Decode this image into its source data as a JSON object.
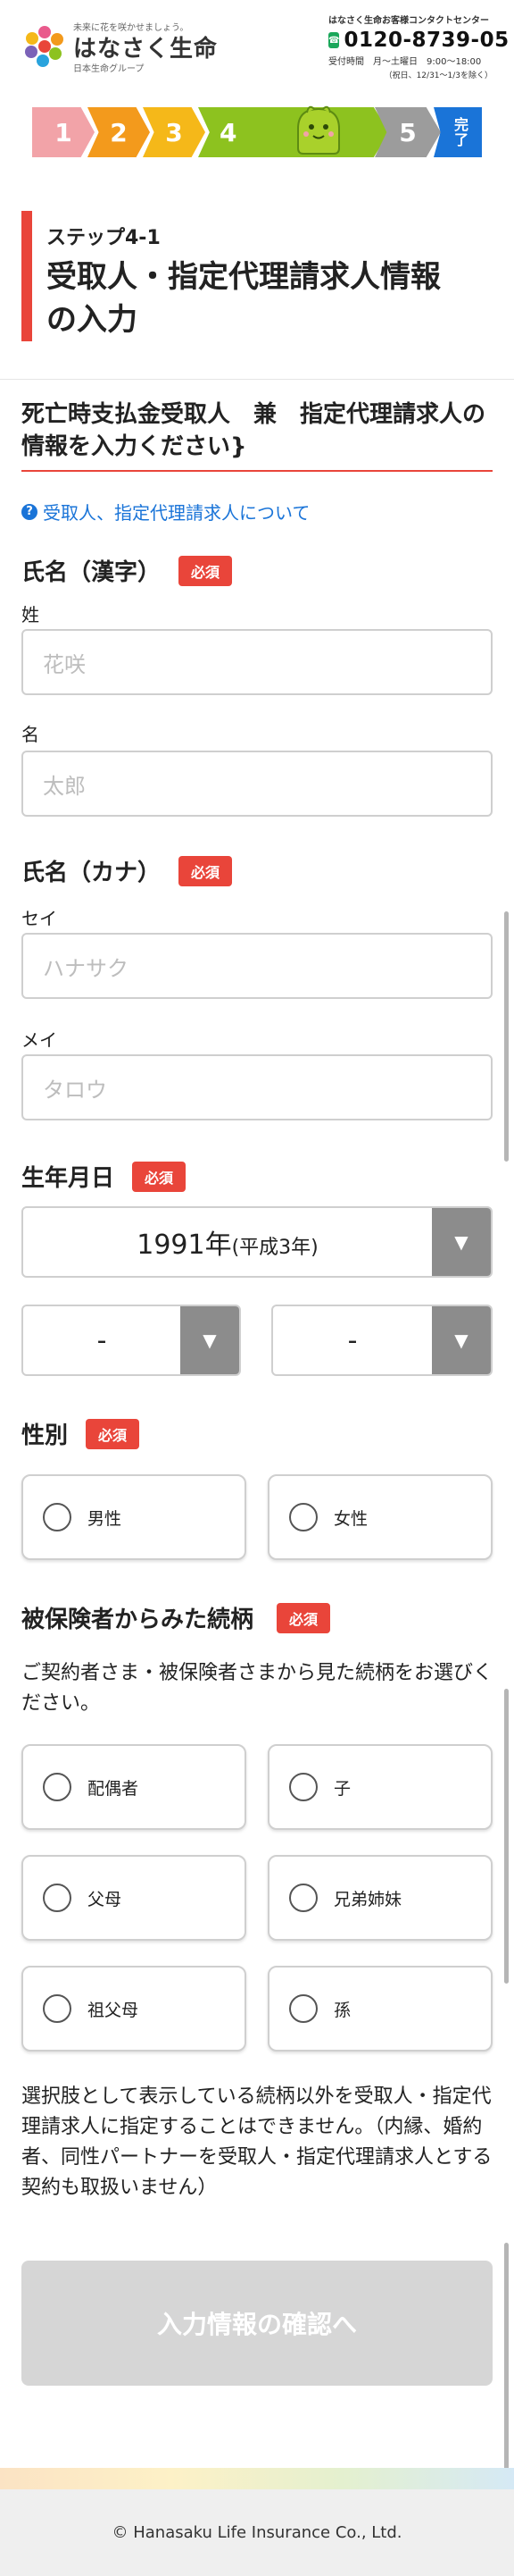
{
  "header": {
    "tagline": "未来に花を咲かせましょう。",
    "logo_name": "はなさく生命",
    "logo_group": "日本生命グループ",
    "contact_title": "はなさく生命お客様コンタクトセンター",
    "freedial_label": "0120",
    "phone": "0120-8739-05",
    "hours": "受付時間　月～土曜日　9:00～18:00",
    "hours_note": "（祝日、12/31～1/3を除く）"
  },
  "stepper": {
    "steps": [
      "1",
      "2",
      "3",
      "4",
      "5",
      "完了"
    ],
    "current_step": "4"
  },
  "page": {
    "step_label": "ステップ4-1",
    "title_line1": "受取人・指定代理請求人情報",
    "title_line2": "の入力"
  },
  "section": {
    "heading": "死亡時支払金受取人　兼　指定代理請求人の情報を入力ください}",
    "help_link": "受取人、指定代理請求人について"
  },
  "form": {
    "required_label": "必須",
    "name_kanji": {
      "label": "氏名（漢字）",
      "last_label": "姓",
      "last_placeholder": "花咲",
      "first_label": "名",
      "first_placeholder": "太郎"
    },
    "name_kana": {
      "label": "氏名（カナ）",
      "last_label": "セイ",
      "last_placeholder": "ハナサク",
      "first_label": "メイ",
      "first_placeholder": "タロウ"
    },
    "birthdate": {
      "label": "生年月日",
      "year_value": "1991年",
      "year_era": "(平成3年)",
      "month_value": "-",
      "day_value": "-"
    },
    "gender": {
      "label": "性別",
      "options": [
        "男性",
        "女性"
      ]
    },
    "relationship": {
      "label": "被保険者からみた続柄",
      "description": "ご契約者さま・被保険者さまから見た続柄をお選びください。",
      "options": [
        "配偶者",
        "子",
        "父母",
        "兄弟姉妹",
        "祖父母",
        "孫"
      ],
      "note": "選択肢として表示している続柄以外を受取人・指定代理請求人に指定することはできません。（内縁、婚約者、同性パートナーを受取人・指定代理請求人とする契約も取扱いません）"
    }
  },
  "submit_label": "入力情報の確認へ",
  "footer": {
    "copyright": "© Hanasaku Life Insurance Co., Ltd."
  },
  "colors": {
    "accent_red": "#e9453a",
    "link_blue": "#1a74d8",
    "step_current": "#8dc21f",
    "freedial_green": "#1aa75a"
  }
}
